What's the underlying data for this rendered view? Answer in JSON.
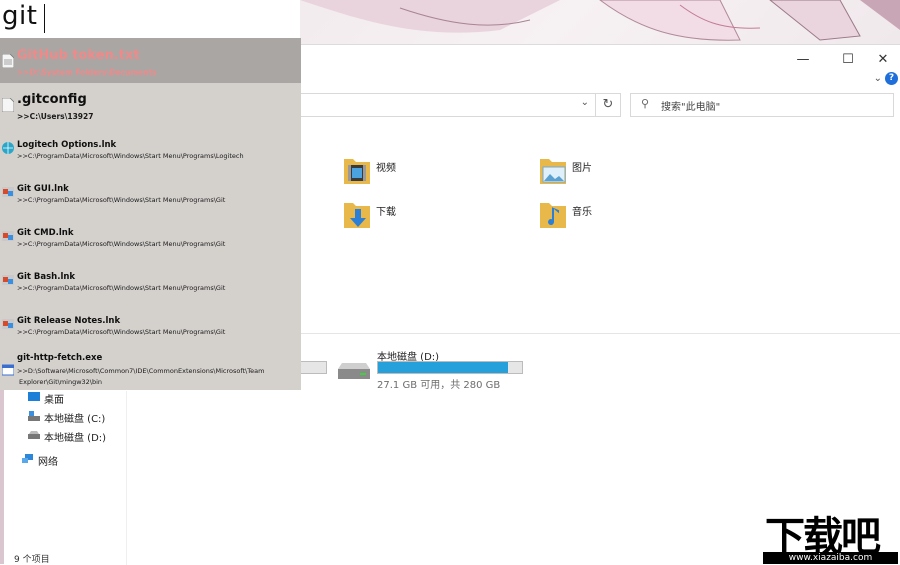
{
  "query": {
    "text": "git"
  },
  "results": [
    {
      "title": "GitHub token.txt",
      "path": ">>D:\\System Folders\\Documents",
      "icon": "text-file-icon"
    },
    {
      "title": ".gitconfig",
      "path": ">>C:\\Users\\13927",
      "icon": "file-icon"
    },
    {
      "title": "Logitech Options.lnk",
      "path": ">>C:\\ProgramData\\Microsoft\\Windows\\Start Menu\\Programs\\Logitech",
      "icon": "globe-shortcut-icon"
    },
    {
      "title": "Git GUI.lnk",
      "path": ">>C:\\ProgramData\\Microsoft\\Windows\\Start Menu\\Programs\\Git",
      "icon": "git-shortcut-icon"
    },
    {
      "title": "Git CMD.lnk",
      "path": ">>C:\\ProgramData\\Microsoft\\Windows\\Start Menu\\Programs\\Git",
      "icon": "git-shortcut-icon"
    },
    {
      "title": "Git Bash.lnk",
      "path": ">>C:\\ProgramData\\Microsoft\\Windows\\Start Menu\\Programs\\Git",
      "icon": "git-shortcut-icon"
    },
    {
      "title": "Git Release Notes.lnk",
      "path": ">>C:\\ProgramData\\Microsoft\\Windows\\Start Menu\\Programs\\Git",
      "icon": "git-shortcut-icon"
    },
    {
      "title": "git-http-fetch.exe",
      "path": ">>D:\\Software\\Microsoft\\Common7\\IDE\\CommonExtensions\\Microsoft\\Team",
      "path2": "Explorer\\Git\\mingw32\\bin",
      "icon": "exe-icon"
    }
  ],
  "explorer": {
    "search_placeholder": "搜索\"此电脑\"",
    "folders": [
      {
        "label": "视频",
        "icon": "video-folder-icon"
      },
      {
        "label": "图片",
        "icon": "pictures-folder-icon"
      },
      {
        "label": "下载",
        "icon": "downloads-folder-icon"
      },
      {
        "label": "音乐",
        "icon": "music-folder-icon"
      }
    ],
    "drive": {
      "label": "本地磁盘 (D:)",
      "space": "27.1 GB 可用，共 280 GB",
      "used_fraction": 0.903
    },
    "nav": [
      {
        "label": "桌面",
        "icon": "desktop-icon"
      },
      {
        "label": "本地磁盘 (C:)",
        "icon": "drive-c-icon"
      },
      {
        "label": "本地磁盘 (D:)",
        "icon": "drive-d-icon"
      },
      {
        "label": "网络",
        "icon": "network-icon"
      }
    ],
    "status": "9 个项目"
  },
  "watermark": {
    "text": "下载吧",
    "url": "www.xiazaiba.com"
  },
  "colors": {
    "selected_text": "#f08a8a",
    "accent": "#26a0da",
    "overlay_bg": "#d4d1cd"
  }
}
